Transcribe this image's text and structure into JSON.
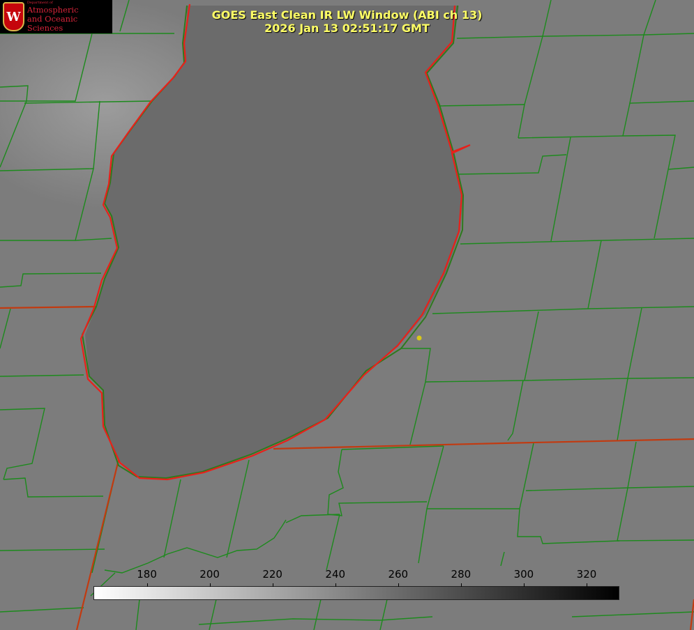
{
  "title": {
    "line1": "GOES East Clean IR LW Window (ABI ch 13)",
    "line2": "2026 Jan 13 02:51:17 GMT"
  },
  "logo": {
    "crest_letter": "W",
    "department": "Department of",
    "line1": "Atmospheric",
    "line2": "and Oceanic Sciences"
  },
  "colorbar": {
    "ticks": [
      "180",
      "200",
      "220",
      "240",
      "260",
      "280",
      "300",
      "320"
    ],
    "tick_values": [
      180,
      200,
      220,
      240,
      260,
      280,
      300,
      320
    ],
    "range": [
      163,
      330
    ],
    "gradient": [
      "#ffffff",
      "#000000"
    ]
  },
  "colors": {
    "county_lines": "#1c8a1c",
    "state_lines": "#c23a10",
    "shoreline": "#e8201a",
    "title": "#ffff66",
    "marker": "#d8c81a"
  }
}
